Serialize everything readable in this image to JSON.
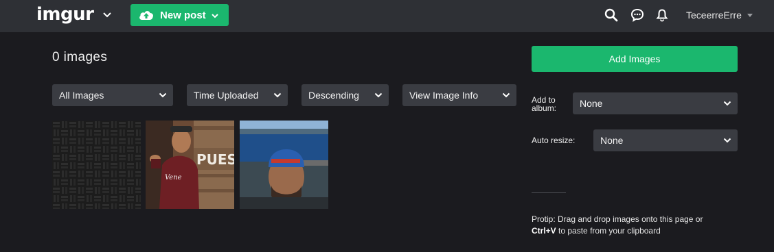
{
  "header": {
    "logo": "imgur",
    "new_post_label": "New post",
    "username": "TeceerreErre",
    "icons": [
      "search-icon",
      "chat-bubble-icon",
      "bell-icon"
    ]
  },
  "main": {
    "image_count": "0 images",
    "filters": [
      {
        "label": "All Images"
      },
      {
        "label": "Time Uploaded"
      },
      {
        "label": "Descending"
      },
      {
        "label": "View Image Info"
      }
    ],
    "thumbnails": [
      "dark-woven-texture",
      "man-pointing-by-wooden-sign",
      "man-selfie-by-sea"
    ]
  },
  "sidebar": {
    "add_images_label": "Add Images",
    "add_to_album_label": "Add to album:",
    "add_to_album_value": "None",
    "auto_resize_label": "Auto resize:",
    "auto_resize_value": "None",
    "protip_text": "Protip: Drag and drop images onto this page or",
    "protip_shortcut": "Ctrl+V",
    "protip_tail": "to paste from your clipboard"
  },
  "colors": {
    "accent": "#1bb76e",
    "header_bg": "#2e3035",
    "page_bg": "#1b1b1f",
    "control_bg": "#3a3c42"
  }
}
